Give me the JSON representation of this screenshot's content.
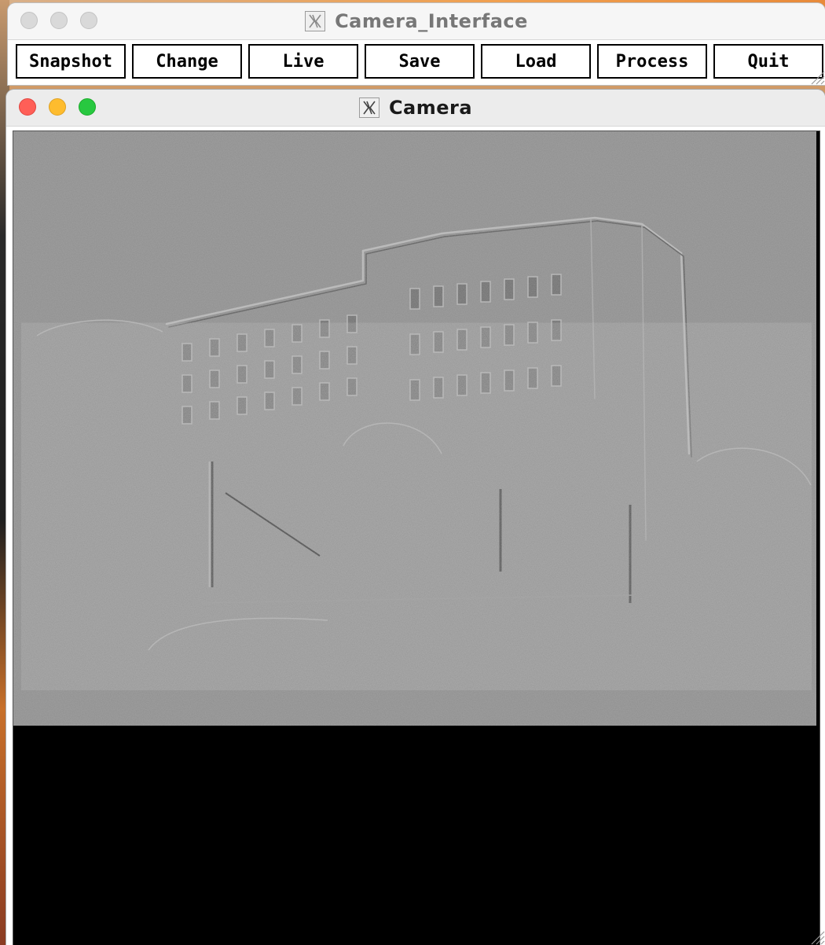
{
  "interface_window": {
    "title": "Camera_Interface",
    "buttons": [
      "Snapshot",
      "Change",
      "Live",
      "Save",
      "Load",
      "Process",
      "Quit"
    ]
  },
  "camera_window": {
    "title": "Camera"
  },
  "icons": {
    "window_app_icon": "x11-icon",
    "resize": "resize-grip-icon"
  },
  "colors": {
    "image_gray": "#8e8e8e",
    "viewport_black": "#000000",
    "close": "#ff5f57",
    "minimize": "#febc2e",
    "zoom": "#28c840"
  }
}
